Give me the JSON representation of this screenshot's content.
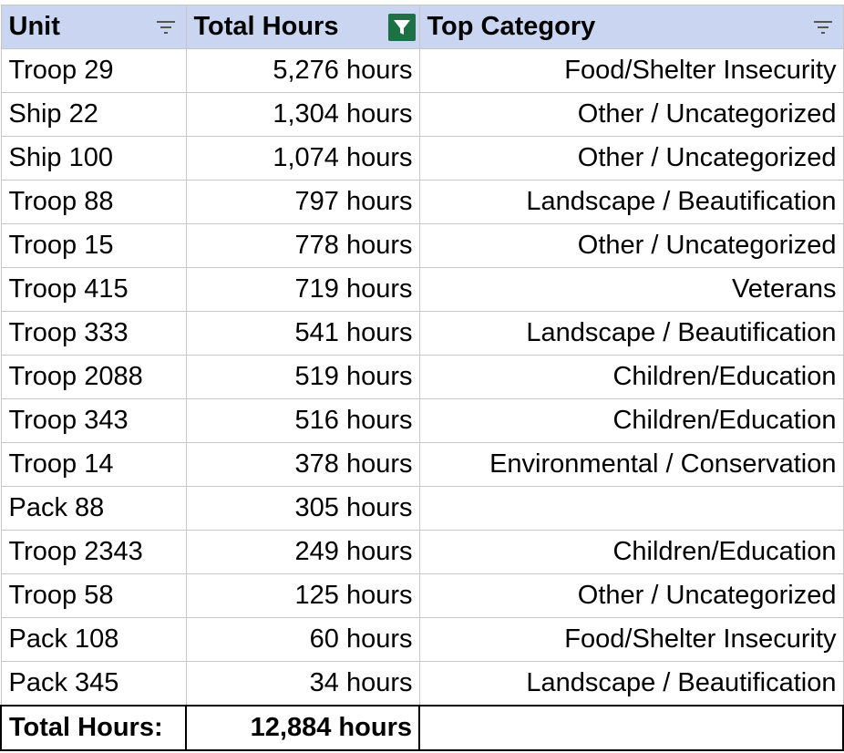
{
  "columns": {
    "unit": "Unit",
    "hours": "Total Hours",
    "category": "Top Category",
    "unit_filter_icon": "filter-lines-icon",
    "hours_filter_icon": "filter-funnel-active-icon",
    "category_filter_icon": "filter-lines-icon"
  },
  "rows": [
    {
      "unit": "Troop 29",
      "hours": "5,276 hours",
      "category": "Food/Shelter Insecurity"
    },
    {
      "unit": "Ship 22",
      "hours": "1,304 hours",
      "category": "Other / Uncategorized"
    },
    {
      "unit": "Ship 100",
      "hours": "1,074 hours",
      "category": "Other / Uncategorized"
    },
    {
      "unit": "Troop 88",
      "hours": "797 hours",
      "category": "Landscape / Beautification"
    },
    {
      "unit": "Troop 15",
      "hours": "778 hours",
      "category": "Other / Uncategorized"
    },
    {
      "unit": "Troop 415",
      "hours": "719 hours",
      "category": "Veterans"
    },
    {
      "unit": "Troop 333",
      "hours": "541 hours",
      "category": "Landscape / Beautification"
    },
    {
      "unit": "Troop 2088",
      "hours": "519 hours",
      "category": "Children/Education"
    },
    {
      "unit": "Troop 343",
      "hours": "516 hours",
      "category": "Children/Education"
    },
    {
      "unit": "Troop 14",
      "hours": "378 hours",
      "category": "Environmental / Conservation"
    },
    {
      "unit": "Pack 88",
      "hours": "305 hours",
      "category": ""
    },
    {
      "unit": "Troop 2343",
      "hours": "249 hours",
      "category": "Children/Education"
    },
    {
      "unit": "Troop 58",
      "hours": "125 hours",
      "category": "Other / Uncategorized"
    },
    {
      "unit": "Pack 108",
      "hours": "60 hours",
      "category": "Food/Shelter Insecurity"
    },
    {
      "unit": "Pack 345",
      "hours": "34 hours",
      "category": "Landscape / Beautification"
    }
  ],
  "total": {
    "label": "Total Hours:",
    "value": "12,884 hours",
    "category": ""
  },
  "colors": {
    "header_bg": "#c9d5f1",
    "gridline": "#c6c6c6",
    "filter_active": "#1e7145"
  }
}
